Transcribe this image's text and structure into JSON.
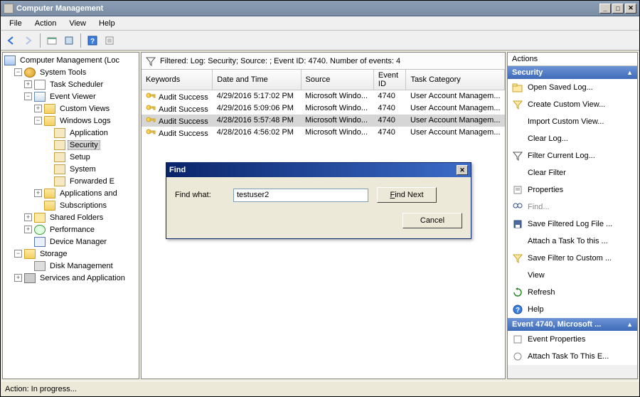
{
  "window": {
    "title": "Computer Management"
  },
  "menu": {
    "file": "File",
    "action": "Action",
    "view": "View",
    "help": "Help"
  },
  "tree": {
    "root": "Computer Management (Loc",
    "system_tools": "System Tools",
    "task_scheduler": "Task Scheduler",
    "event_viewer": "Event Viewer",
    "custom_views": "Custom Views",
    "windows_logs": "Windows Logs",
    "application": "Application",
    "security": "Security",
    "setup": "Setup",
    "system": "System",
    "forwarded": "Forwarded E",
    "applications_and": "Applications and",
    "subscriptions": "Subscriptions",
    "shared_folders": "Shared Folders",
    "performance": "Performance",
    "device_manager": "Device Manager",
    "storage": "Storage",
    "disk_management": "Disk Management",
    "services_and": "Services and Application"
  },
  "filter": {
    "text": "Filtered: Log: Security; Source: ; Event ID: 4740. Number of events: 4"
  },
  "grid": {
    "headers": {
      "keywords": "Keywords",
      "date_time": "Date and Time",
      "source": "Source",
      "event_id": "Event ID",
      "task_category": "Task Category"
    },
    "rows": [
      {
        "keywords": "Audit Success",
        "date_time": "4/29/2016 5:17:02 PM",
        "source": "Microsoft Windo...",
        "event_id": "4740",
        "task_category": "User Account Managem...",
        "selected": false
      },
      {
        "keywords": "Audit Success",
        "date_time": "4/29/2016 5:09:06 PM",
        "source": "Microsoft Windo...",
        "event_id": "4740",
        "task_category": "User Account Managem...",
        "selected": false
      },
      {
        "keywords": "Audit Success",
        "date_time": "4/28/2016 5:57:48 PM",
        "source": "Microsoft Windo...",
        "event_id": "4740",
        "task_category": "User Account Managem...",
        "selected": true
      },
      {
        "keywords": "Audit Success",
        "date_time": "4/28/2016 4:56:02 PM",
        "source": "Microsoft Windo...",
        "event_id": "4740",
        "task_category": "User Account Managem...",
        "selected": false
      }
    ]
  },
  "actions": {
    "header": "Actions",
    "section1": "Security",
    "open_saved_log": "Open Saved Log...",
    "create_custom_view": "Create Custom View...",
    "import_custom_view": "Import Custom View...",
    "clear_log": "Clear Log...",
    "filter_current_log": "Filter Current Log...",
    "clear_filter": "Clear Filter",
    "properties": "Properties",
    "find": "Find...",
    "save_filtered": "Save Filtered Log File ...",
    "attach_task": "Attach a Task To this ...",
    "save_filter_custom": "Save Filter to Custom ...",
    "view": "View",
    "refresh": "Refresh",
    "help": "Help",
    "section2": "Event 4740, Microsoft ...",
    "event_properties": "Event Properties",
    "attach_task_event": "Attach Task To This E..."
  },
  "find_dialog": {
    "title": "Find",
    "find_what_label": "Find what:",
    "find_what_value": "testuser2",
    "find_next": "Find Next",
    "cancel": "Cancel"
  },
  "status": {
    "text": "Action:  In progress..."
  }
}
